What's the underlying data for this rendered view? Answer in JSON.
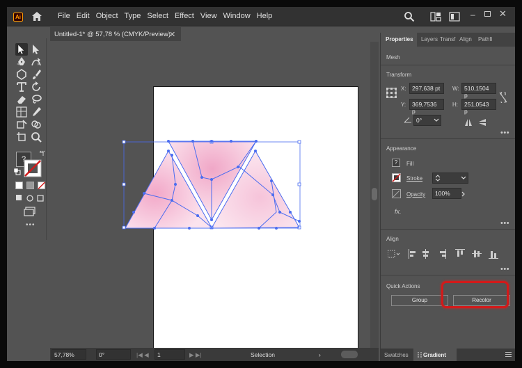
{
  "app": {
    "logo_text": "Ai"
  },
  "menu": [
    "File",
    "Edit",
    "Object",
    "Type",
    "Select",
    "Effect",
    "View",
    "Window",
    "Help"
  ],
  "document": {
    "tab_title": "Untitled-1* @ 57,78 % (CMYK/Preview)",
    "close_glyph": "✕"
  },
  "tools": [
    "selection-tool-icon",
    "direct-selection-tool-icon",
    "pen-tool-icon",
    "curvature-tool-icon",
    "shape-tool-icon",
    "paintbrush-tool-icon",
    "type-tool-icon",
    "rotate-tool-icon",
    "eraser-tool-icon",
    "lasso-tool-icon",
    "graph-tool-icon",
    "eyedropper-tool-icon",
    "free-transform-tool-icon",
    "shape-builder-tool-icon",
    "artboard-tool-icon",
    "zoom-tool-icon"
  ],
  "fill_stroke": {
    "fill_unknown_glyph": "?"
  },
  "status_bar": {
    "zoom": "57,78%",
    "rotation": "0°",
    "artboard_number": "1",
    "tool_name": "Selection"
  },
  "properties": {
    "tabs": [
      "Properties",
      "Layers",
      "Transf",
      "Align",
      "Pathfi"
    ],
    "object_type": "Mesh",
    "transform": {
      "title": "Transform",
      "x_label": "X:",
      "x_value": "297,638 pt",
      "y_label": "Y:",
      "y_value": "369,7536 p",
      "w_label": "W:",
      "w_value": "510,1504 p",
      "h_label": "H:",
      "h_value": "251,0543 p",
      "angle_value": "0°"
    },
    "appearance": {
      "title": "Appearance",
      "fill_label": "Fill",
      "stroke_label": "Stroke",
      "opacity_label": "Opacity",
      "opacity_value": "100%",
      "fx_label": "fx."
    },
    "align": {
      "title": "Align"
    },
    "quick_actions": {
      "title": "Quick Actions",
      "group_label": "Group",
      "recolor_label": "Recolor"
    },
    "more_glyph": "•••"
  },
  "bottom_tabs": [
    "Swatches",
    "Gradient"
  ],
  "colors": {
    "highlight": "#d21a1a",
    "mesh_line": "#4a6cf0",
    "mesh_fill": "#f7d3e4"
  }
}
